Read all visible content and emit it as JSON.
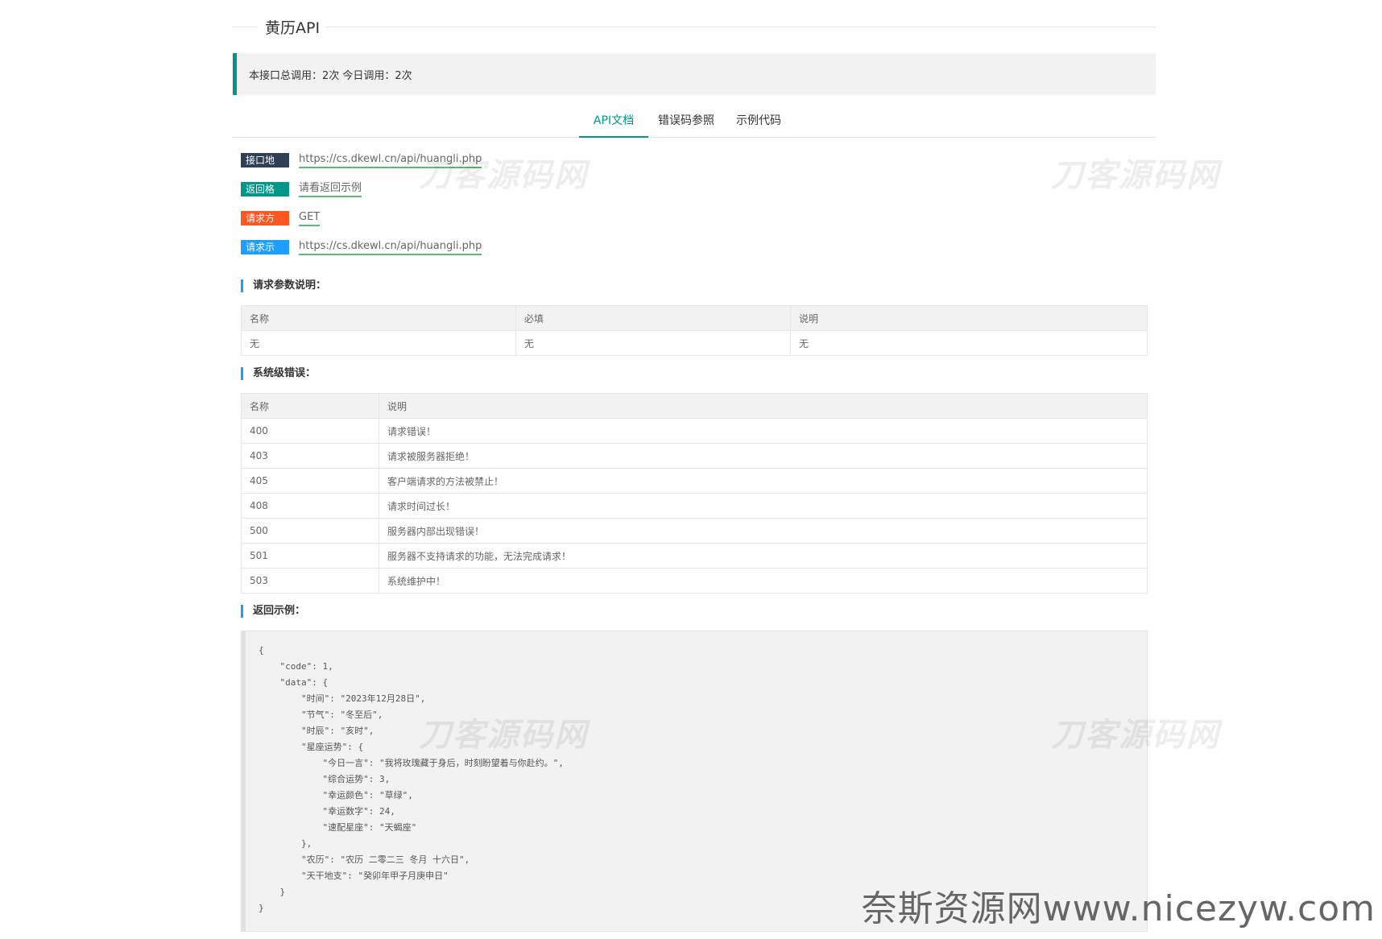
{
  "page": {
    "title": "黄历API"
  },
  "stats": {
    "text": "本接口总调用：2次 今日调用：2次"
  },
  "tabs": [
    {
      "label": "API文档",
      "active": true
    },
    {
      "label": "错误码参照",
      "active": false
    },
    {
      "label": "示例代码",
      "active": false
    }
  ],
  "info": {
    "address_label": "接口地址：",
    "address_value": "https://cs.dkewl.cn/api/huangli.php",
    "format_label": "返回格式：",
    "format_value": "请看返回示例",
    "method_label": "请求方式：",
    "method_value": "GET",
    "example_label": "请求示例：",
    "example_value": "https://cs.dkewl.cn/api/huangli.php"
  },
  "params_section": {
    "title": "请求参数说明：",
    "headers": [
      "名称",
      "必填",
      "说明"
    ],
    "rows": [
      [
        "无",
        "无",
        "无"
      ]
    ]
  },
  "errors_section": {
    "title": "系统级错误：",
    "headers": [
      "名称",
      "说明"
    ],
    "rows": [
      [
        "400",
        "请求错误！"
      ],
      [
        "403",
        "请求被服务器拒绝！"
      ],
      [
        "405",
        "客户端请求的方法被禁止！"
      ],
      [
        "408",
        "请求时间过长！"
      ],
      [
        "500",
        "服务器内部出现错误！"
      ],
      [
        "501",
        "服务器不支持请求的功能，无法完成请求！"
      ],
      [
        "503",
        "系统维护中！"
      ]
    ]
  },
  "response_section": {
    "title": "返回示例：",
    "code": "{\n    \"code\": 1,\n    \"data\": {\n        \"时间\": \"2023年12月28日\",\n        \"节气\": \"冬至后\",\n        \"时辰\": \"亥时\",\n        \"星座运势\": {\n            \"今日一言\": \"我将玫瑰藏于身后，时刻盼望着与你赴约。\",\n            \"综合运势\": 3,\n            \"幸运颜色\": \"草绿\",\n            \"幸运数字\": 24,\n            \"速配星座\": \"天蝎座\"\n        },\n        \"农历\": \"农历 二零二三 冬月 十六日\",\n        \"天干地支\": \"癸卯年甲子月庚申日\"\n    }\n}"
  },
  "watermarks": {
    "brand": "刀客源码网",
    "footer": "奈斯资源网www.nicezyw.com"
  }
}
